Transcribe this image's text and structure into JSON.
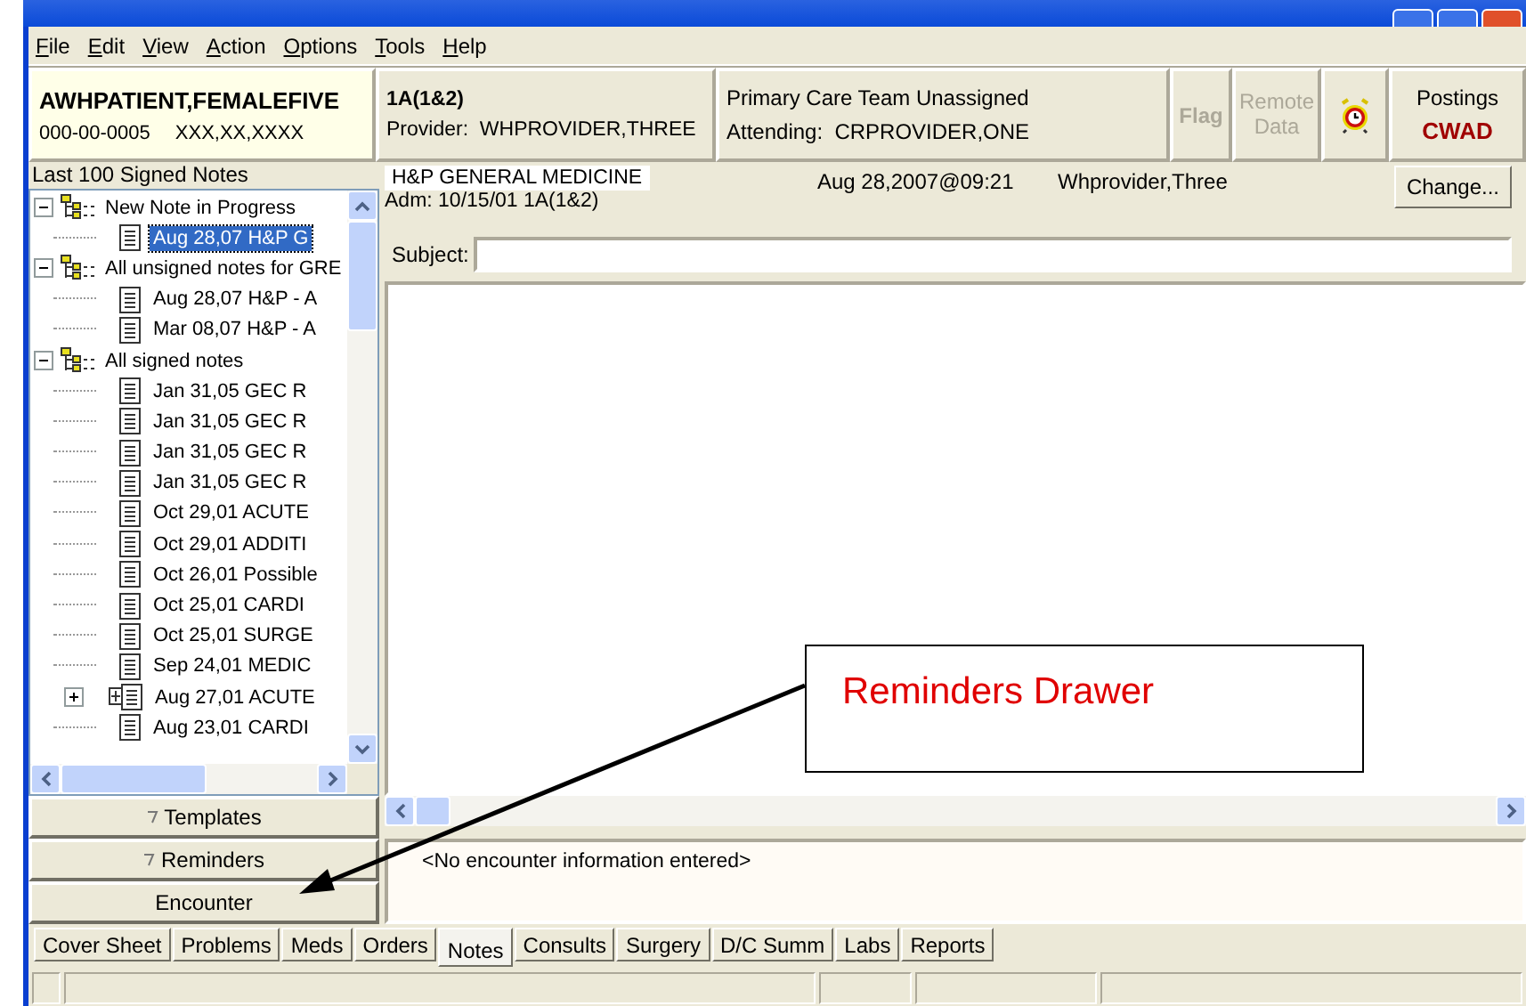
{
  "menu": [
    "File",
    "Edit",
    "View",
    "Action",
    "Options",
    "Tools",
    "Help"
  ],
  "patient": {
    "name": "AWHPATIENT,FEMALEFIVE",
    "ssn": "000-00-0005",
    "dob": "XXX,XX,XXXX"
  },
  "location": {
    "ward": "1A(1&2)",
    "provider_label": "Provider:",
    "provider": "WHPROVIDER,THREE"
  },
  "team": {
    "name": "Primary Care Team Unassigned",
    "attending_label": "Attending:",
    "attending": "CRPROVIDER,ONE"
  },
  "flag_button": {
    "label": "Flag",
    "disabled": true
  },
  "remote_button": {
    "label": "Remote Data",
    "disabled": true
  },
  "postings": {
    "label": "Postings",
    "code": "CWAD"
  },
  "tree_title": "Last 100 Signed Notes",
  "tree": [
    {
      "label": "New Note in Progress",
      "expanded": true,
      "children": [
        {
          "label": "Aug 28,07  H&P G",
          "selected": true,
          "expandable": false
        }
      ]
    },
    {
      "label": "All unsigned notes for GRE",
      "expanded": true,
      "children": [
        {
          "label": "Aug 28,07  H&P - A",
          "selected": false,
          "expandable": false
        },
        {
          "label": "Mar 08,07  H&P - A",
          "selected": false,
          "expandable": false
        }
      ]
    },
    {
      "label": "All signed notes",
      "expanded": true,
      "children": [
        {
          "label": "Jan 31,05  GEC R",
          "selected": false,
          "expandable": false
        },
        {
          "label": "Jan 31,05  GEC R",
          "selected": false,
          "expandable": false
        },
        {
          "label": "Jan 31,05  GEC R",
          "selected": false,
          "expandable": false
        },
        {
          "label": "Jan 31,05  GEC R",
          "selected": false,
          "expandable": false
        },
        {
          "label": "Oct 29,01  ACUTE",
          "selected": false,
          "expandable": false
        },
        {
          "label": "Oct 29,01  ADDITI",
          "selected": false,
          "expandable": false
        },
        {
          "label": "Oct 26,01  Possible",
          "selected": false,
          "expandable": false
        },
        {
          "label": "Oct 25,01  CARDI",
          "selected": false,
          "expandable": false
        },
        {
          "label": "Oct 25,01  SURGE",
          "selected": false,
          "expandable": false
        },
        {
          "label": "Sep 24,01  MEDIC",
          "selected": false,
          "expandable": false
        },
        {
          "label": "Aug 27,01  ACUTE",
          "selected": false,
          "expandable": true
        },
        {
          "label": "Aug 23,01  CARDI",
          "selected": false,
          "expandable": false
        }
      ]
    }
  ],
  "drawers": [
    {
      "label": "Templates",
      "collapsible": true
    },
    {
      "label": "Reminders",
      "collapsible": true
    },
    {
      "label": "Encounter",
      "collapsible": false
    }
  ],
  "note": {
    "title": "H&P GENERAL MEDICINE",
    "admission": "Adm: 10/15/01  1A(1&2)",
    "date": "Aug 28,2007@09:21",
    "author": "Whprovider,Three",
    "change_button": "Change...",
    "subject_label": "Subject:"
  },
  "encounter_text": "<No encounter information entered>",
  "tabs": [
    {
      "label": "Cover Sheet",
      "selected": false
    },
    {
      "label": "Problems",
      "selected": false
    },
    {
      "label": "Meds",
      "selected": false
    },
    {
      "label": "Orders",
      "selected": false
    },
    {
      "label": "Notes",
      "selected": true
    },
    {
      "label": "Consults",
      "selected": false
    },
    {
      "label": "Surgery",
      "selected": false
    },
    {
      "label": "D/C Summ",
      "selected": false
    },
    {
      "label": "Labs",
      "selected": false
    },
    {
      "label": "Reports",
      "selected": false
    }
  ],
  "callout": {
    "label": "Reminders Drawer"
  }
}
